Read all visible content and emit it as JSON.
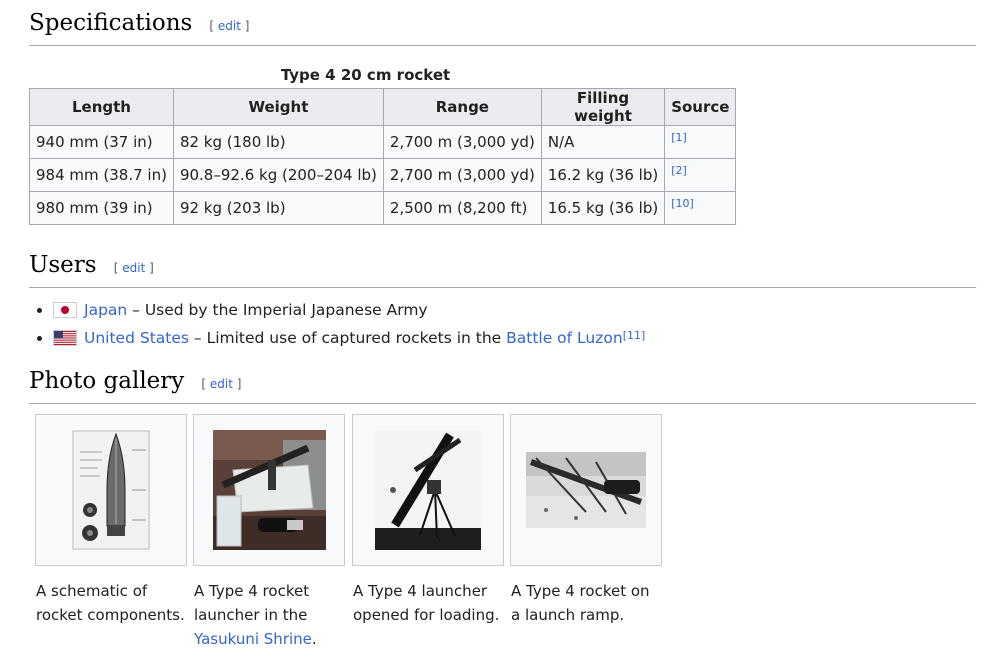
{
  "sections": {
    "specifications": {
      "title": "Specifications",
      "edit": "edit"
    },
    "users": {
      "title": "Users",
      "edit": "edit"
    },
    "gallery": {
      "title": "Photo gallery",
      "edit": "edit"
    }
  },
  "table": {
    "caption": "Type 4 20 cm rocket",
    "headers": [
      "Length",
      "Weight",
      "Range",
      "Filling weight",
      "Source"
    ],
    "rows": [
      [
        "940 mm (37 in)",
        "82 kg (180 lb)",
        "2,700 m (3,000 yd)",
        "N/A",
        "[1]"
      ],
      [
        "984 mm (38.7 in)",
        "90.8–92.6 kg (200–204 lb)",
        "2,700 m (3,000 yd)",
        "16.2 kg (36 lb)",
        "[2]"
      ],
      [
        "980 mm (39 in)",
        "92 kg (203 lb)",
        "2,500 m (8,200 ft)",
        "16.5 kg (36 lb)",
        "[10]"
      ]
    ]
  },
  "users": [
    {
      "flag_icon": "japan-flag-icon",
      "country": "Japan",
      "desc": " – Used by the Imperial Japanese Army",
      "link": "",
      "ref": ""
    },
    {
      "flag_icon": "us-flag-icon",
      "country": "United States",
      "desc": " – Limited use of captured rockets in the ",
      "link": "Battle of Luzon",
      "ref": "[11]"
    }
  ],
  "gallery": [
    {
      "image_icon": "rocket-schematic-image",
      "caption": "A schematic of rocket components.",
      "link": "",
      "tail": ""
    },
    {
      "image_icon": "rocket-launcher-photo",
      "caption": "A Type 4 rocket launcher in the ",
      "link": "Yasukuni Shrine",
      "tail": "."
    },
    {
      "image_icon": "launcher-loading-photo",
      "caption": "A Type 4 launcher opened for loading.",
      "link": "",
      "tail": ""
    },
    {
      "image_icon": "launch-ramp-photo",
      "caption": "A Type 4 rocket on a launch ramp.",
      "link": "",
      "tail": ""
    }
  ],
  "colors": {
    "link": "#3366cc",
    "border": "#a2a9b1",
    "header_bg": "#eaecf0",
    "table_bg": "#f8f9fa"
  }
}
